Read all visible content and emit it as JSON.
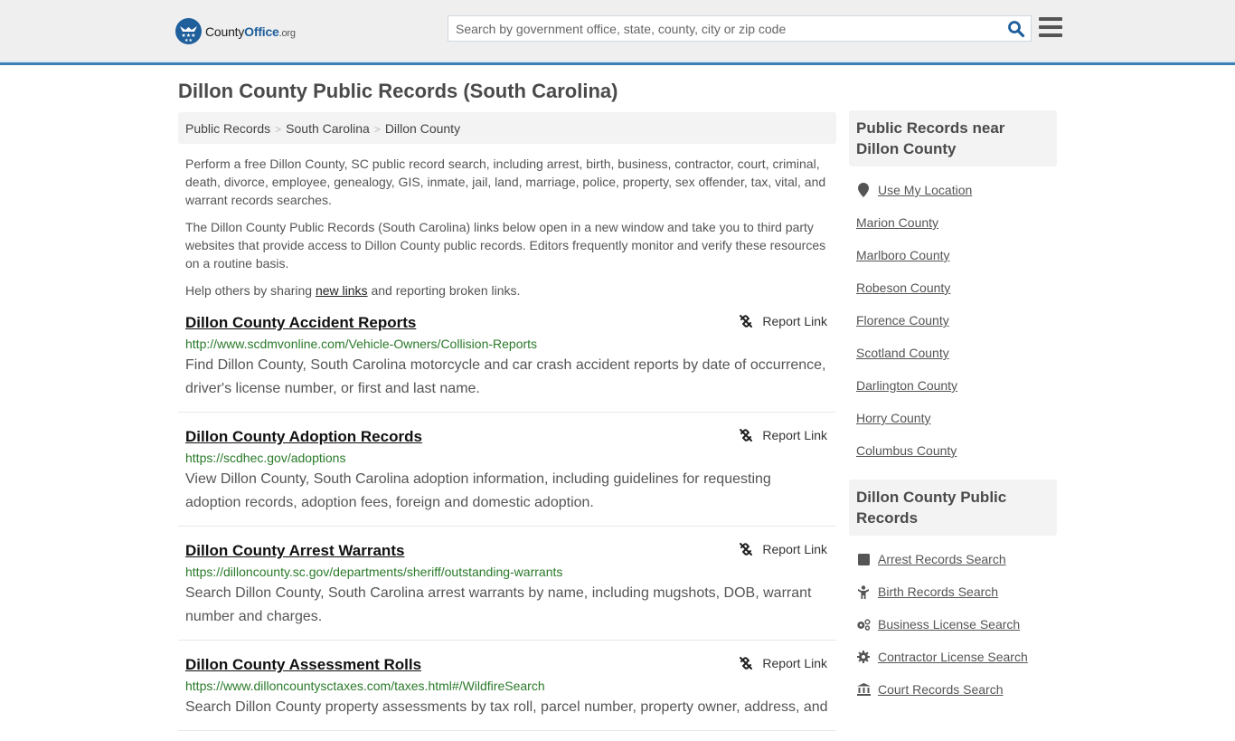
{
  "header": {
    "logo": {
      "name": "County",
      "accent": "Office",
      "tld": ".org"
    },
    "search": {
      "placeholder": "Search by government office, state, county, city or zip code",
      "value": ""
    },
    "colors": {
      "brand": "#1e5f9c",
      "accent_bar": "#3a7fb5"
    }
  },
  "page": {
    "title": "Dillon County Public Records (South Carolina)",
    "breadcrumb": [
      "Public Records",
      "South Carolina",
      "Dillon County"
    ],
    "intro": [
      "Perform a free Dillon County, SC public record search, including arrest, birth, business, contractor, court, criminal, death, divorce, employee, genealogy, GIS, inmate, jail, land, marriage, police, property, sex offender, tax, vital, and warrant records searches.",
      "The Dillon County Public Records (South Carolina) links below open in a new window and take you to third party websites that provide access to Dillon County public records. Editors frequently monitor and verify these resources on a routine basis."
    ],
    "help": {
      "before": "Help others by sharing ",
      "link": "new links",
      "after": " and reporting broken links."
    },
    "report_label": "Report Link",
    "records": [
      {
        "title": "Dillon County Accident Reports",
        "url": "http://www.scdmvonline.com/Vehicle-Owners/Collision-Reports",
        "desc": "Find Dillon County, South Carolina motorcycle and car crash accident reports by date of occurrence, driver's license number, or first and last name."
      },
      {
        "title": "Dillon County Adoption Records",
        "url": "https://scdhec.gov/adoptions",
        "desc": "View Dillon County, South Carolina adoption information, including guidelines for requesting adoption records, adoption fees, foreign and domestic adoption."
      },
      {
        "title": "Dillon County Arrest Warrants",
        "url": "https://dilloncounty.sc.gov/departments/sheriff/outstanding-warrants",
        "desc": "Search Dillon County, South Carolina arrest warrants by name, including mugshots, DOB, warrant number and charges."
      },
      {
        "title": "Dillon County Assessment Rolls",
        "url": "https://www.dilloncountysctaxes.com/taxes.html#/WildfireSearch",
        "desc": "Search Dillon County property assessments by tax roll, parcel number, property owner, address, and"
      }
    ]
  },
  "sidebar": {
    "nearby": {
      "heading": "Public Records near Dillon County",
      "location_label": "Use My Location",
      "counties": [
        "Marion County",
        "Marlboro County",
        "Robeson County",
        "Florence County",
        "Scotland County",
        "Darlington County",
        "Horry County",
        "Columbus County"
      ]
    },
    "records": {
      "heading": "Dillon County Public Records",
      "items": [
        {
          "label": "Arrest Records Search",
          "icon": "square-icon"
        },
        {
          "label": "Birth Records Search",
          "icon": "child-icon"
        },
        {
          "label": "Business License Search",
          "icon": "cogs-icon"
        },
        {
          "label": "Contractor License Search",
          "icon": "gear-icon"
        },
        {
          "label": "Court Records Search",
          "icon": "courthouse-icon"
        }
      ]
    }
  }
}
